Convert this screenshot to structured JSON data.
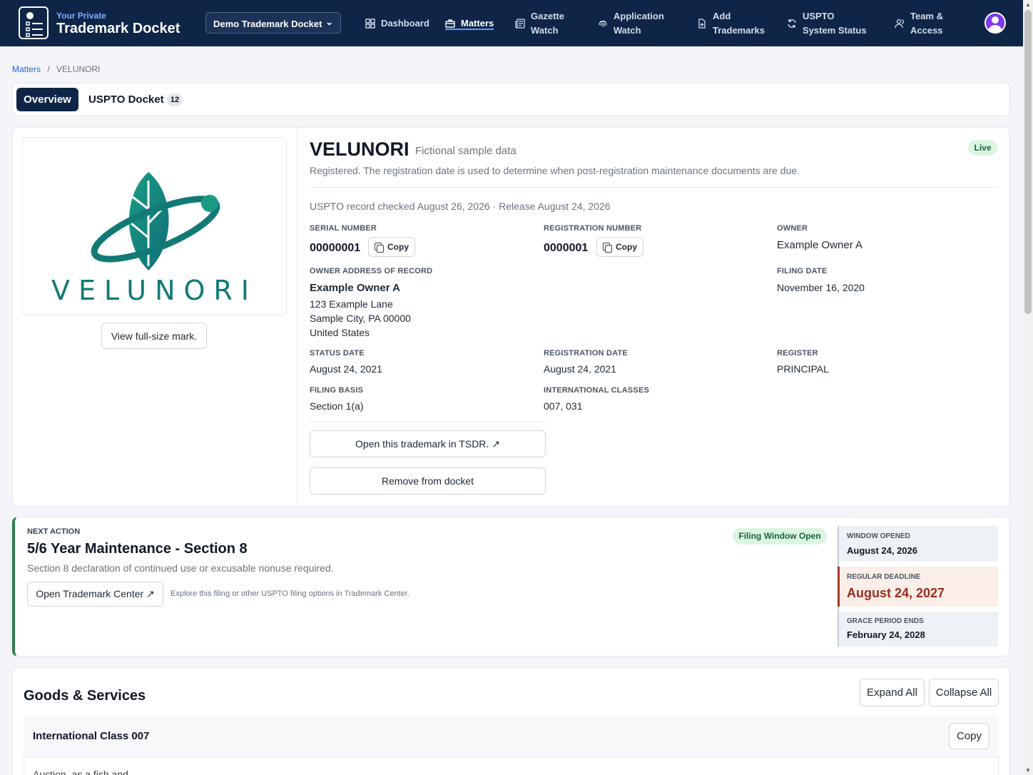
{
  "app": {
    "brand_small": "Your Private",
    "brand_name": "Trademark Docket"
  },
  "docket_selector": {
    "selected": "Demo Trademark Docket"
  },
  "nav": {
    "items": [
      {
        "label": "Dashboard",
        "icon": "grid-icon"
      },
      {
        "label": "Matters",
        "icon": "briefcase-icon",
        "active": true
      },
      {
        "label": "Gazette Watch",
        "icon": "newspaper-icon"
      },
      {
        "label": "Application Watch",
        "icon": "fingerprint-icon"
      },
      {
        "label": "Add Trademarks",
        "icon": "file-plus-icon"
      },
      {
        "label": "USPTO System Status",
        "icon": "refresh-icon"
      },
      {
        "label": "Team & Access",
        "icon": "users-icon"
      }
    ]
  },
  "breadcrumb": {
    "root": "Matters",
    "separator": "/",
    "current": "VELUNORI"
  },
  "tabs": {
    "overview": "Overview",
    "docket": "USPTO Docket",
    "docket_count": "12"
  },
  "mark": {
    "wordmark": "VELUNORI",
    "view_button": "View full-size mark.",
    "brand_color": "#127a76"
  },
  "record": {
    "name": "VELUNORI",
    "tag": "Fictional sample data",
    "status_badge": "Live",
    "description": "Registered. The registration date is used to determine when post-registration maintenance documents are due.",
    "checked": "USPTO record checked August 26, 2026 · Release August 24, 2026",
    "copy_label": "Copy",
    "fields": {
      "serial_number": {
        "label": "SERIAL NUMBER",
        "value": "00000001"
      },
      "registration_number": {
        "label": "REGISTRATION NUMBER",
        "value": "0000001"
      },
      "owner": {
        "label": "OWNER",
        "value": "Example Owner A"
      },
      "owner_address": {
        "label": "OWNER ADDRESS OF RECORD",
        "name": "Example Owner A",
        "line1": "123 Example Lane",
        "line2": "Sample City, PA 00000",
        "line3": "United States"
      },
      "filing_date": {
        "label": "FILING DATE",
        "value": "November 16, 2020"
      },
      "status_date": {
        "label": "STATUS DATE",
        "value": "August 24, 2021"
      },
      "registration_date": {
        "label": "REGISTRATION DATE",
        "value": "August 24, 2021"
      },
      "register": {
        "label": "REGISTER",
        "value": "PRINCIPAL"
      },
      "filing_basis": {
        "label": "FILING BASIS",
        "value": "Section 1(a)"
      },
      "international_classes": {
        "label": "INTERNATIONAL CLASSES",
        "value": "007, 031"
      }
    },
    "open_tsdr": "Open this trademark in TSDR. ↗",
    "remove": "Remove from docket"
  },
  "next_action": {
    "label": "NEXT ACTION",
    "title": "5/6 Year Maintenance - Section 8",
    "description": "Section 8 declaration of continued use or excusable nonuse required.",
    "button": "Open Trademark Center ↗",
    "hint": "Explore this filing or other USPTO filing options in Trademark Center.",
    "badge": "Filing Window Open",
    "dates": [
      {
        "label": "WINDOW OPENED",
        "value": "August 24, 2026"
      },
      {
        "label": "REGULAR DEADLINE",
        "value": "August 24, 2027"
      },
      {
        "label": "GRACE PERIOD ENDS",
        "value": "February 24, 2028"
      }
    ]
  },
  "goods_services": {
    "title": "Goods & Services",
    "expand_all": "Expand All",
    "collapse_all": "Collapse All",
    "classes": [
      {
        "title": "International Class 007",
        "copy": "Copy",
        "text": "Auction, as a fish and"
      }
    ]
  },
  "colors": {
    "nav_bg": "#0f2548",
    "accent": "#2563eb",
    "success": "#166534",
    "deadline": "#9b2c1f"
  }
}
